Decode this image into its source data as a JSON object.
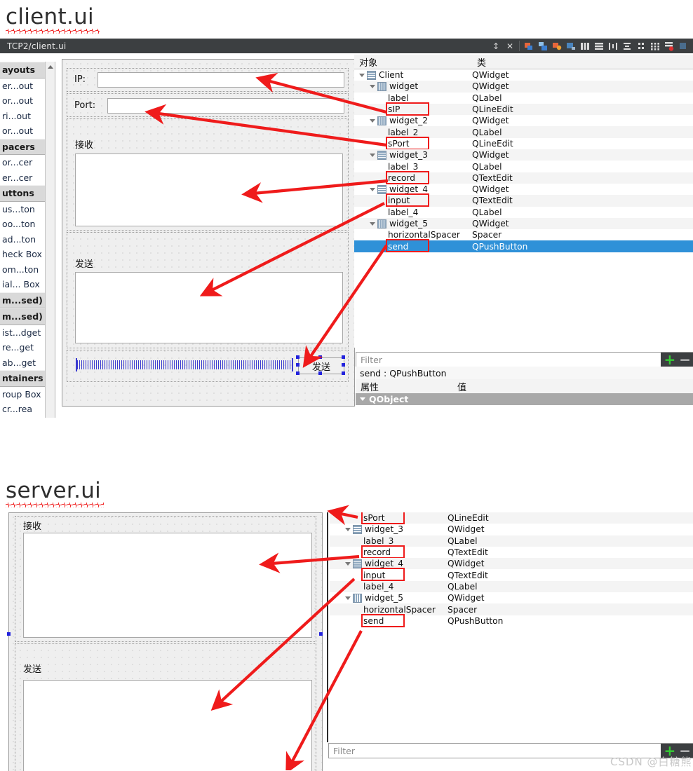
{
  "sections": {
    "client": {
      "title": "client.ui"
    },
    "server": {
      "title": "server.ui"
    }
  },
  "qt": {
    "window_title": "TCP2/client.ui",
    "toolbar_icons": [
      "updown-arrows-icon",
      "close-icon",
      "break-layout-icon",
      "adjust-size-icon",
      "lay-out-in-a-form-icon",
      "lay-out-in-a-splitter-icon",
      "lay-out-horizontally-icon",
      "lay-out-vertically-icon",
      "lay-out-horizontally-in-splitter-icon",
      "lay-out-vertically-in-splitter-icon",
      "lay-out-in-a-grid-icon",
      "lay-out-in-a-form-layout-icon",
      "break-layout-red-icon",
      "adjust-size-2-icon"
    ]
  },
  "widget_box": {
    "items": [
      {
        "label": "ayouts",
        "header": true
      },
      {
        "label": "er...out",
        "header": false
      },
      {
        "label": "or...out",
        "header": false
      },
      {
        "label": "ri...out",
        "header": false
      },
      {
        "label": "or...out",
        "header": false
      },
      {
        "label": "pacers",
        "header": true
      },
      {
        "label": "or...cer",
        "header": false
      },
      {
        "label": "er...cer",
        "header": false
      },
      {
        "label": "uttons",
        "header": true
      },
      {
        "label": "us...ton",
        "header": false
      },
      {
        "label": "oo...ton",
        "header": false
      },
      {
        "label": "ad...ton",
        "header": false
      },
      {
        "label": "heck Box",
        "header": false
      },
      {
        "label": "om...ton",
        "header": false
      },
      {
        "label": "ial... Box",
        "header": false
      },
      {
        "label": "m...sed)",
        "header": true
      },
      {
        "label": "m...sed)",
        "header": true
      },
      {
        "label": "ist...dget",
        "header": false
      },
      {
        "label": "re...get",
        "header": false
      },
      {
        "label": "ab...get",
        "header": false
      },
      {
        "label": "ntainers",
        "header": true
      },
      {
        "label": "roup Box",
        "header": false
      },
      {
        "label": "cr...rea",
        "header": false
      }
    ]
  },
  "client_form": {
    "ip_label": "IP:",
    "port_label": "Port:",
    "receive_label": "接收",
    "send_label": "发送",
    "ip_value": "",
    "port_value": "",
    "record_value": "",
    "input_value": "",
    "send_button": "发送"
  },
  "client_tree": {
    "columns": {
      "object": "对象",
      "class": "类"
    },
    "rows": [
      {
        "name": "Client",
        "class": "QWidget",
        "indent": 0,
        "twirl": true,
        "icon": "v",
        "boxed": false,
        "selected": false
      },
      {
        "name": "widget",
        "class": "QWidget",
        "indent": 1,
        "twirl": true,
        "icon": "h",
        "boxed": false,
        "selected": false
      },
      {
        "name": "label",
        "class": "QLabel",
        "indent": 2,
        "twirl": false,
        "icon": "none",
        "boxed": false,
        "selected": false
      },
      {
        "name": "sIP",
        "class": "QLineEdit",
        "indent": 2,
        "twirl": false,
        "icon": "none",
        "boxed": true,
        "selected": false
      },
      {
        "name": "widget_2",
        "class": "QWidget",
        "indent": 1,
        "twirl": true,
        "icon": "h",
        "boxed": false,
        "selected": false
      },
      {
        "name": "label_2",
        "class": "QLabel",
        "indent": 2,
        "twirl": false,
        "icon": "none",
        "boxed": false,
        "selected": false
      },
      {
        "name": "sPort",
        "class": "QLineEdit",
        "indent": 2,
        "twirl": false,
        "icon": "none",
        "boxed": true,
        "selected": false
      },
      {
        "name": "widget_3",
        "class": "QWidget",
        "indent": 1,
        "twirl": true,
        "icon": "v",
        "boxed": false,
        "selected": false
      },
      {
        "name": "label_3",
        "class": "QLabel",
        "indent": 2,
        "twirl": false,
        "icon": "none",
        "boxed": false,
        "selected": false
      },
      {
        "name": "record",
        "class": "QTextEdit",
        "indent": 2,
        "twirl": false,
        "icon": "none",
        "boxed": true,
        "selected": false
      },
      {
        "name": "widget_4",
        "class": "QWidget",
        "indent": 1,
        "twirl": true,
        "icon": "v",
        "boxed": false,
        "selected": false
      },
      {
        "name": "input",
        "class": "QTextEdit",
        "indent": 2,
        "twirl": false,
        "icon": "none",
        "boxed": true,
        "selected": false
      },
      {
        "name": "label_4",
        "class": "QLabel",
        "indent": 2,
        "twirl": false,
        "icon": "none",
        "boxed": false,
        "selected": false
      },
      {
        "name": "widget_5",
        "class": "QWidget",
        "indent": 1,
        "twirl": true,
        "icon": "h",
        "boxed": false,
        "selected": false
      },
      {
        "name": "horizontalSpacer",
        "class": "Spacer",
        "indent": 2,
        "twirl": false,
        "icon": "none",
        "boxed": false,
        "selected": false
      },
      {
        "name": "send",
        "class": "QPushButton",
        "indent": 2,
        "twirl": false,
        "icon": "none",
        "boxed": true,
        "selected": true
      }
    ]
  },
  "client_props": {
    "filter_placeholder": "Filter",
    "add_button": "+",
    "remove_button": "−",
    "object_line": "send : QPushButton",
    "columns": {
      "property": "属性",
      "value": "值"
    },
    "group": "QObject"
  },
  "server_form": {
    "receive_label": "接收",
    "send_label": "发送"
  },
  "server_tree": {
    "rows": [
      {
        "name": "sPort",
        "class": "QLineEdit",
        "indent": 2,
        "twirl": false,
        "icon": "none",
        "boxed": true
      },
      {
        "name": "widget_3",
        "class": "QWidget",
        "indent": 1,
        "twirl": true,
        "icon": "v",
        "boxed": false
      },
      {
        "name": "label_3",
        "class": "QLabel",
        "indent": 2,
        "twirl": false,
        "icon": "none",
        "boxed": false
      },
      {
        "name": "record",
        "class": "QTextEdit",
        "indent": 2,
        "twirl": false,
        "icon": "none",
        "boxed": true
      },
      {
        "name": "widget_4",
        "class": "QWidget",
        "indent": 1,
        "twirl": true,
        "icon": "v",
        "boxed": false
      },
      {
        "name": "input",
        "class": "QTextEdit",
        "indent": 2,
        "twirl": false,
        "icon": "none",
        "boxed": true
      },
      {
        "name": "label_4",
        "class": "QLabel",
        "indent": 2,
        "twirl": false,
        "icon": "none",
        "boxed": false
      },
      {
        "name": "widget_5",
        "class": "QWidget",
        "indent": 1,
        "twirl": true,
        "icon": "h",
        "boxed": false
      },
      {
        "name": "horizontalSpacer",
        "class": "Spacer",
        "indent": 2,
        "twirl": false,
        "icon": "none",
        "boxed": false
      },
      {
        "name": "send",
        "class": "QPushButton",
        "indent": 2,
        "twirl": false,
        "icon": "none",
        "boxed": true
      }
    ]
  },
  "server_props": {
    "filter_placeholder": "Filter",
    "add_button": "+",
    "remove_button": "−"
  },
  "watermark": "CSDN @白糖熊",
  "colors": {
    "titlebar": "#3c3f41",
    "selection": "#2f91d8",
    "annotation": "#ef1b1b",
    "canvas": "#efefef",
    "add_green": "#33cc33"
  }
}
